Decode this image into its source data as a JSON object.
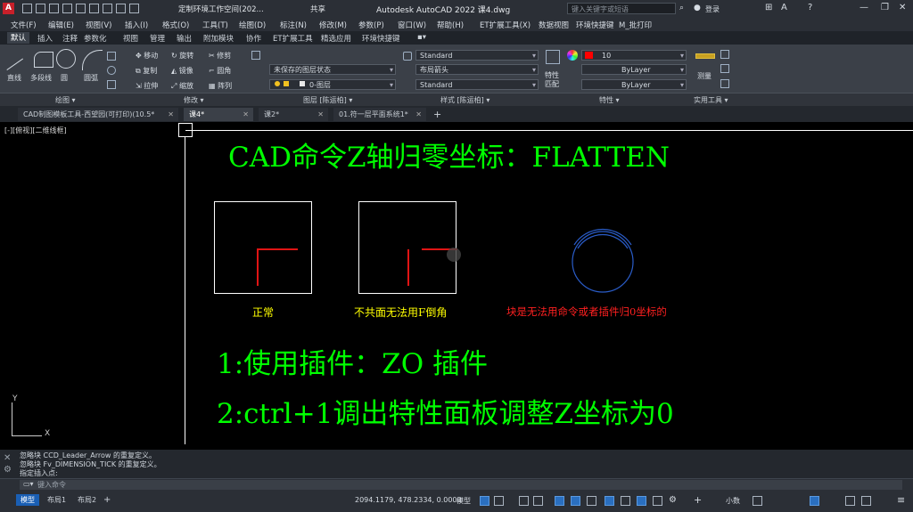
{
  "window": {
    "title": "Autodesk AutoCAD 2022    课4.dwg",
    "workspace": "定制环境工作空间(202...",
    "share_label": "共享",
    "search_placeholder": "键入关键字或短语",
    "signin_label": "登录"
  },
  "menu": [
    "文件(F)",
    "编辑(E)",
    "视图(V)",
    "插入(I)",
    "格式(O)",
    "工具(T)",
    "绘图(D)",
    "标注(N)",
    "修改(M)",
    "参数(P)",
    "窗口(W)",
    "帮助(H)",
    "ET扩展工具(X)",
    "数据视图",
    "环境快捷键",
    "M_批打印"
  ],
  "ribbon_tabs": [
    "默认",
    "插入",
    "注释",
    "参数化",
    "视图",
    "管理",
    "输出",
    "附加模块",
    "协作",
    "ET扩展工具",
    "精选应用",
    "环境快捷键"
  ],
  "ribbon": {
    "draw_tools": [
      "直线",
      "多段线",
      "圆",
      "圆弧"
    ],
    "modify_tools": [
      "移动",
      "旋转",
      "修剪",
      "复制",
      "镜像",
      "圆角",
      "拉伸",
      "缩放",
      "阵列"
    ],
    "layer_state": "未保存的图层状态",
    "layer_current": "0-图层",
    "text_style": "Standard",
    "dim_style": "布局箭头",
    "table_style": "Standard",
    "color_value": "10",
    "linetype": "ByLayer",
    "lineweight": "ByLayer",
    "match_props": "特性匹配",
    "measure": "测量",
    "panels": [
      "绘图 ▾",
      "修改 ▾",
      "图层 [陈运柏] ▾",
      "样式 [陈运柏] ▾",
      "特性 ▾",
      "实用工具 ▾"
    ]
  },
  "doc_tabs": [
    {
      "label": "CAD制图模板工具-西望园(可打印)(10.5*",
      "active": false
    },
    {
      "label": "课4*",
      "active": true
    },
    {
      "label": "课2*",
      "active": false
    },
    {
      "label": "01.符一层平面系统1*",
      "active": false
    }
  ],
  "drawing": {
    "viewport_label": "[-][俯视][二维线框]",
    "heading": "CAD命令Z轴归零坐标：FLATTEN",
    "label_normal": "正常",
    "label_noncoplanar": "不共面无法用F倒角",
    "label_block": "块是无法用命令或者插件归0坐标的",
    "line1": "1:使用插件：ZO 插件",
    "line2": "2:ctrl+1调出特性面板调整Z坐标为0",
    "ucs_x": "X",
    "ucs_y": "Y",
    "colors": {
      "text": "#00ff00",
      "label_yellow": "#ffff00",
      "label_red": "#ff2020",
      "geometry_red": "#e01414",
      "arc_blue": "#2a5cc8"
    }
  },
  "command": {
    "history": [
      "忽略块 CCD_Leader_Arrow 的重复定义。",
      "忽略块 Fv_DIMENSION_TICK 的重复定义。",
      "指定插入点:"
    ],
    "input_placeholder": "键入命令"
  },
  "status": {
    "layout_tabs": [
      {
        "label": "模型",
        "active": true
      },
      {
        "label": "布局1",
        "active": false
      },
      {
        "label": "布局2",
        "active": false
      }
    ],
    "coordinates": "2094.1179, 478.2334, 0.0000",
    "model_label": "模型",
    "scale_label": "小数"
  }
}
